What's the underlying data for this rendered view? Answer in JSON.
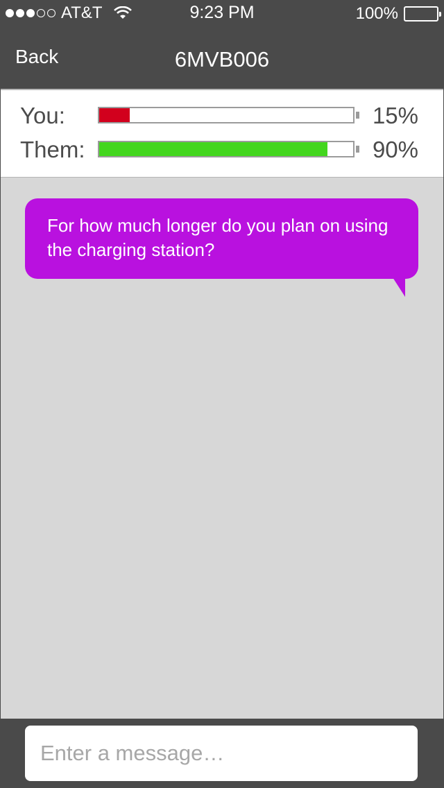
{
  "status_bar": {
    "carrier": "AT&T",
    "time": "9:23 PM",
    "battery": "100%",
    "signal_bars_filled": 3,
    "signal_bars_total": 5
  },
  "nav": {
    "back_label": "Back",
    "title": "6MVB006"
  },
  "levels": [
    {
      "label": "You:",
      "percent_label": "15%",
      "value": 0.12,
      "color": "#d2001d"
    },
    {
      "label": "Them:",
      "percent_label": "90%",
      "value": 0.9,
      "color": "#43d61e"
    }
  ],
  "messages": [
    {
      "text": "For how much longer do you plan on using the charging station?",
      "color": "#b911df"
    }
  ],
  "composer": {
    "placeholder": "Enter a message…"
  }
}
